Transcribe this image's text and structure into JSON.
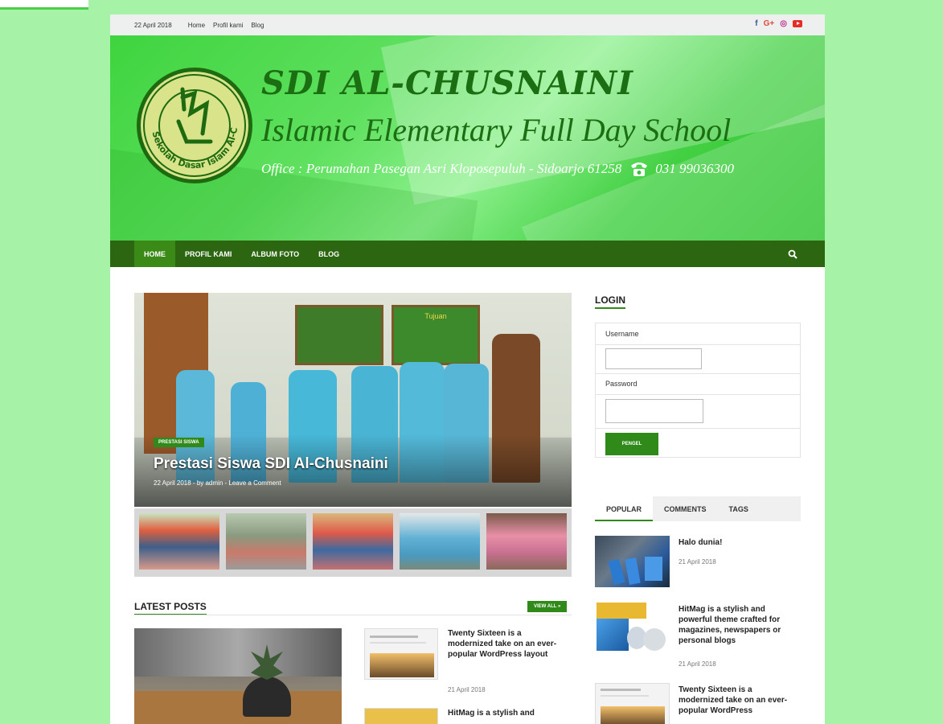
{
  "topbar": {
    "date": "22 April 2018",
    "links": [
      "Home",
      "Profil kami",
      "Blog"
    ]
  },
  "header": {
    "title": "SDI AL-CHUSNAINI",
    "subtitle": "Islamic Elementary Full Day School",
    "office": "Office : Perumahan Pasegan Asri Kloposepuluh - Sidoarjo 61258",
    "phone": "031 99036300",
    "logo_text": "Sekolah Dasar Islam Al-Chusnaini"
  },
  "nav": {
    "items": [
      "HOME",
      "PROFIL KAMI",
      "ALBUM FOTO",
      "BLOG"
    ],
    "active": "HOME"
  },
  "slider": {
    "category": "PRESTASI SISWA",
    "title": "Prestasi Siswa SDI Al-Chusnaini",
    "meta": "22 April 2018 - by admin - Leave a Comment",
    "board_text": "Tujuan"
  },
  "latest": {
    "title": "LATEST POSTS",
    "view_all": "VIEW ALL »",
    "posts": [
      {
        "title": "Twenty Sixteen is a modernized take on an ever-popular WordPress layout",
        "date": "21 April 2018"
      },
      {
        "title": "HitMag is a stylish and",
        "date": ""
      }
    ]
  },
  "sidebar": {
    "login_title": "LOGIN",
    "username_label": "Username",
    "password_label": "Password",
    "login_button": "PENGEL",
    "tabs": [
      "POPULAR",
      "COMMENTS",
      "TAGS"
    ],
    "popular": [
      {
        "title": "Halo dunia!",
        "date": "21 April 2018"
      },
      {
        "title": "HitMag is a stylish and powerful theme crafted for magazines, newspapers or personal blogs",
        "date": "21 April 2018"
      },
      {
        "title": "Twenty Sixteen is a modernized take on an ever-popular WordPress",
        "date": ""
      }
    ]
  },
  "colors": {
    "page_bg": "#a6f2a6",
    "nav_bg": "#2c6611",
    "accent": "#2f8a1a",
    "title_green": "#1c6e12"
  }
}
